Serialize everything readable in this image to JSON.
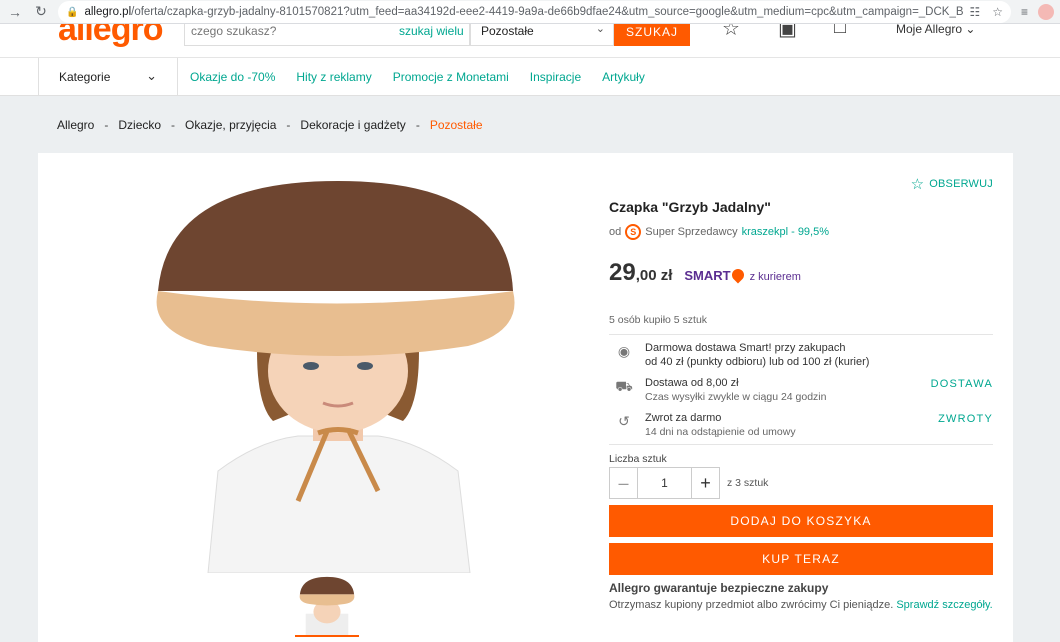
{
  "browser": {
    "url_host": "allegro.pl",
    "url_path": "/oferta/czapka-grzyb-jadalny-8101570821?utm_feed=aa34192d-eee2-4419-9a9a-de66b9dfae24&utm_source=google&utm_medium=cpc&utm_campaign=_DCK_BG_pla..."
  },
  "header": {
    "logo": "allegro",
    "search_placeholder": "czego szukasz?",
    "search_many": "szukaj wielu",
    "category_select": "Pozostałe",
    "search_button": "SZUKAJ",
    "account": "Moje Allegro"
  },
  "nav": {
    "categories_label": "Kategorie",
    "links": [
      "Okazje do -70%",
      "Hity z reklamy",
      "Promocje z Monetami",
      "Inspiracje",
      "Artykuły"
    ]
  },
  "breadcrumb": [
    "Allegro",
    "Dziecko",
    "Okazje, przyjęcia",
    "Dekoracje i gadżety",
    "Pozostałe"
  ],
  "product": {
    "observe": "OBSERWUJ",
    "title": "Czapka \"Grzyb Jadalny\"",
    "seller_prefix": "od",
    "seller_badge": "Super Sprzedawcy",
    "seller_name": "kraszekpl - 99,5%",
    "price_main": "29",
    "price_decimal": ",00 zł",
    "smart_label": "SMART",
    "courier": "z kurierem",
    "bought": "5 osób kupiło 5 sztuk",
    "delivery_smart_line1": "Darmowa dostawa Smart! przy zakupach",
    "delivery_smart_line2": "od 40 zł (punkty odbioru) lub od 100 zł (kurier)",
    "shipping_line1": "Dostawa od 8,00 zł",
    "shipping_line2": "Czas wysyłki zwykle w ciągu 24 godzin",
    "shipping_link": "DOSTAWA",
    "returns_line1": "Zwrot za darmo",
    "returns_line2": "14 dni na odstąpienie od umowy",
    "returns_link": "ZWROTY",
    "quantity_label": "Liczba sztuk",
    "quantity_value": "1",
    "quantity_max": "z 3 sztuk",
    "add_to_cart": "DODAJ DO KOSZYKA",
    "buy_now": "KUP TERAZ",
    "guarantee_title": "Allegro gwarantuje bezpieczne zakupy",
    "guarantee_text": "Otrzymasz kupiony przedmiot albo zwrócimy Ci pieniądze.",
    "guarantee_link": "Sprawdź szczegóły."
  },
  "colors": {
    "brand_orange": "#ff5a00",
    "accent_teal": "#00a790",
    "smart_purple": "#5b2e91"
  }
}
